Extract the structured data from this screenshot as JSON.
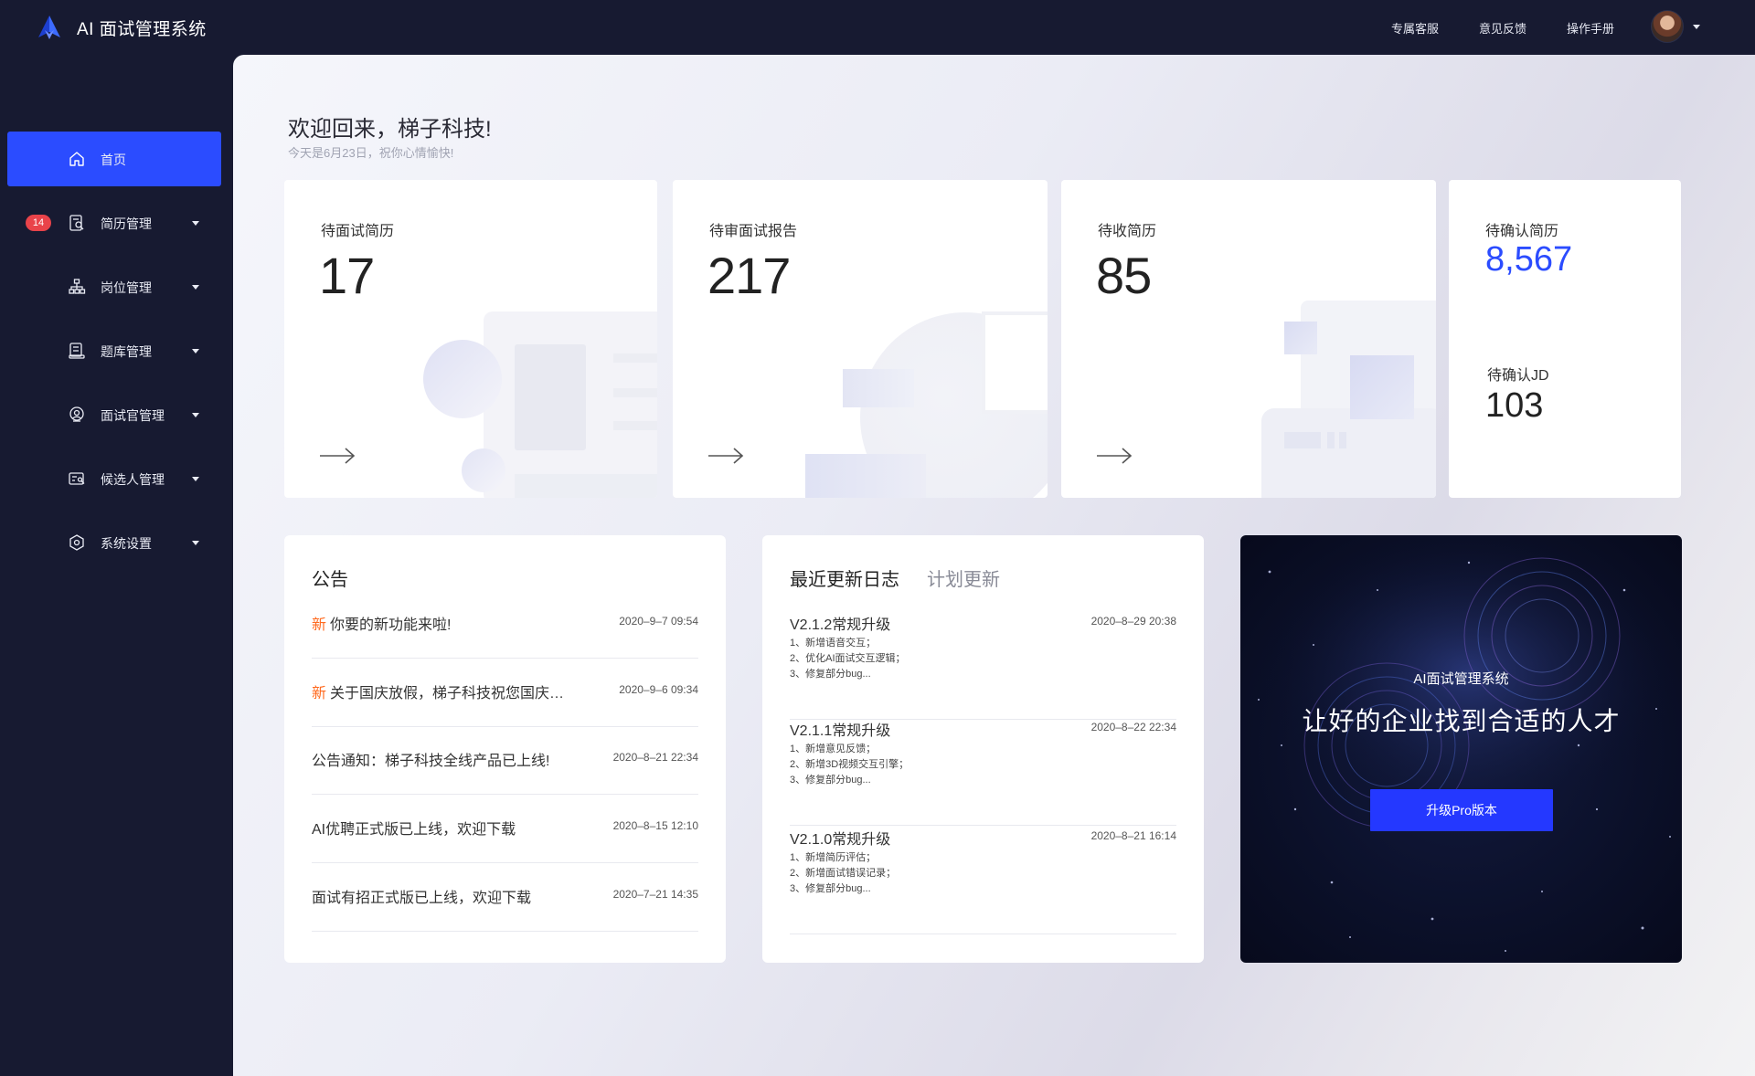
{
  "app": {
    "title": "AI 面试管理系统"
  },
  "top_links": [
    "专属客服",
    "意见反馈",
    "操作手册"
  ],
  "sidebar": {
    "items": [
      {
        "label": "首页",
        "icon": "home-icon",
        "active": true
      },
      {
        "label": "简历管理",
        "icon": "resume-search-icon",
        "badge": "14"
      },
      {
        "label": "岗位管理",
        "icon": "org-chart-icon"
      },
      {
        "label": "题库管理",
        "icon": "question-bank-icon"
      },
      {
        "label": "面试官管理",
        "icon": "interviewer-icon"
      },
      {
        "label": "候选人管理",
        "icon": "candidate-icon"
      },
      {
        "label": "系统设置",
        "icon": "settings-icon"
      }
    ]
  },
  "welcome": {
    "title": "欢迎回来，梯子科技!",
    "subtitle": "今天是6月23日，祝你心情愉快!"
  },
  "stats": [
    {
      "label": "待面试简历",
      "value": "17"
    },
    {
      "label": "待审面试报告",
      "value": "217"
    },
    {
      "label": "待收简历",
      "value": "85"
    }
  ],
  "confirm": {
    "resume_label": "待确认简历",
    "resume_value": "8,567",
    "jd_label": "待确认JD",
    "jd_value": "103",
    "accent": "#2b4cff"
  },
  "announcements": {
    "title": "公告",
    "new_tag": "新",
    "items": [
      {
        "new": true,
        "text": "你要的新功能来啦!",
        "date": "2020–9–7 09:54"
      },
      {
        "new": true,
        "text": "关于国庆放假，梯子科技祝您国庆…",
        "date": "2020–9–6 09:34"
      },
      {
        "new": false,
        "text": "公告通知：梯子科技全线产品已上线!",
        "date": "2020–8–21 22:34"
      },
      {
        "new": false,
        "text": "AI优聘正式版已上线，欢迎下载",
        "date": "2020–8–15 12:10"
      },
      {
        "new": false,
        "text": "面试有招正式版已上线，欢迎下载",
        "date": "2020–7–21 14:35"
      }
    ]
  },
  "updates": {
    "tab_recent": "最近更新日志",
    "tab_planned": "计划更新",
    "items": [
      {
        "version": "V2.1.2常规升级",
        "date": "2020–8–29 20:38",
        "lines": [
          "1、新增语音交互；",
          "2、优化AI面试交互逻辑；",
          "3、修复部分bug..."
        ]
      },
      {
        "version": "V2.1.1常规升级",
        "date": "2020–8–22 22:34",
        "lines": [
          "1、新增意见反馈；",
          "2、新增3D视频交互引擎；",
          "3、修复部分bug..."
        ]
      },
      {
        "version": "V2.1.0常规升级",
        "date": "2020–8–21 16:14",
        "lines": [
          "1、新增简历评估；",
          "2、新增面试错误记录；",
          "3、修复部分bug..."
        ]
      }
    ]
  },
  "promo": {
    "kicker": "AI面试管理系统",
    "title": "让好的企业找到合适的人才",
    "button": "升级Pro版本"
  }
}
